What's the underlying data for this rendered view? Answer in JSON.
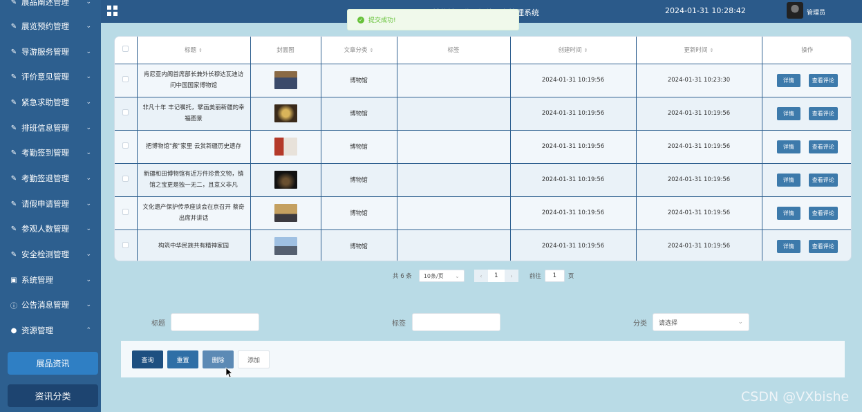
{
  "sidebar": {
    "items": [
      {
        "label": "展品阐述管理",
        "icon": "edit-icon"
      },
      {
        "label": "展览预约管理",
        "icon": "edit-icon"
      },
      {
        "label": "导游服务管理",
        "icon": "edit-icon"
      },
      {
        "label": "评价意见管理",
        "icon": "edit-icon"
      },
      {
        "label": "紧急求助管理",
        "icon": "edit-icon"
      },
      {
        "label": "排班信息管理",
        "icon": "edit-icon"
      },
      {
        "label": "考勤签到管理",
        "icon": "edit-icon"
      },
      {
        "label": "考勤签退管理",
        "icon": "edit-icon"
      },
      {
        "label": "请假申请管理",
        "icon": "edit-icon"
      },
      {
        "label": "参观人数管理",
        "icon": "edit-icon"
      },
      {
        "label": "安全检测管理",
        "icon": "edit-icon"
      },
      {
        "label": "系统管理",
        "icon": "image-icon"
      },
      {
        "label": "公告消息管理",
        "icon": "info-icon"
      },
      {
        "label": "资源管理",
        "icon": "location-icon"
      }
    ],
    "sub_items": [
      "展品资讯",
      "资讯分类"
    ]
  },
  "header": {
    "title": "博物馆导览与智能服务管理系统",
    "datetime": "2024-01-31 10:28:42",
    "user": "管理员"
  },
  "toast": {
    "message": "提交成功!"
  },
  "table": {
    "columns": [
      "标题",
      "封面图",
      "文章分类",
      "标签",
      "创建时间",
      "更新时间",
      "操作"
    ],
    "rows": [
      {
        "title": "肯尼亚内阁首席部长兼外长穆达瓦迪访问中国国家博物馆",
        "category": "博物馆",
        "tag": "",
        "created": "2024-01-31 10:19:56",
        "updated": "2024-01-31 10:23:30"
      },
      {
        "title": "非凡十年 丰记嘱托，擘画美丽新疆的幸福图景",
        "category": "博物馆",
        "tag": "",
        "created": "2024-01-31 10:19:56",
        "updated": "2024-01-31 10:19:56"
      },
      {
        "title": "把博物馆\"搬\"家里 云赏新疆历史遗存",
        "category": "博物馆",
        "tag": "",
        "created": "2024-01-31 10:19:56",
        "updated": "2024-01-31 10:19:56"
      },
      {
        "title": "新疆和田博物馆有近万件珍贵文物，镇馆之宝更是独一无二，且意义非凡",
        "category": "博物馆",
        "tag": "",
        "created": "2024-01-31 10:19:56",
        "updated": "2024-01-31 10:19:56"
      },
      {
        "title": "文化遗产保护传承座谈会在京召开 蔡奇出席并讲话",
        "category": "博物馆",
        "tag": "",
        "created": "2024-01-31 10:19:56",
        "updated": "2024-01-31 10:19:56"
      },
      {
        "title": "构筑中华民族共有精神家园",
        "category": "博物馆",
        "tag": "",
        "created": "2024-01-31 10:19:56",
        "updated": "2024-01-31 10:19:56"
      }
    ],
    "row_actions": {
      "detail": "详情",
      "comments": "查看评论"
    }
  },
  "pagination": {
    "total": "共 6 条",
    "page_size": "10条/页",
    "current_page": "1",
    "goto_prefix": "前往",
    "goto_value": "1",
    "goto_suffix": "页"
  },
  "search": {
    "title_label": "标题",
    "title_value": "",
    "tag_label": "标签",
    "tag_value": "",
    "category_label": "分类",
    "category_placeholder": "请选择"
  },
  "actions": {
    "query": "查询",
    "reset": "重置",
    "delete": "删除",
    "add": "添加"
  },
  "watermark": "CSDN @VXbishe",
  "colors": {
    "sidebar": "#2d5f8f",
    "header": "#2b5a8a",
    "page_bg": "#b9dbe6",
    "primary_button": "#1d5a92",
    "success": "#67c23a"
  }
}
